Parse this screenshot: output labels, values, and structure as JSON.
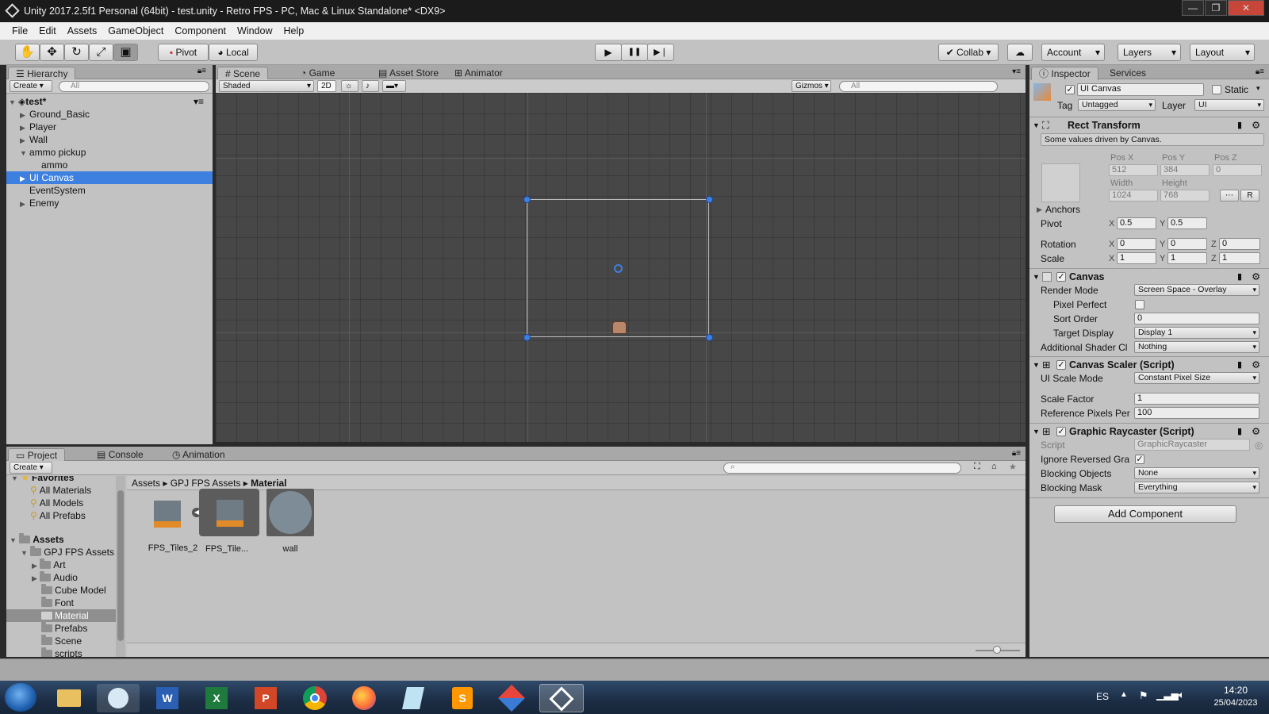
{
  "window": {
    "title": "Unity 2017.2.5f1 Personal (64bit) - test.unity - Retro FPS - PC, Mac & Linux Standalone* <DX9>",
    "minimize": "—",
    "maximize": "❐",
    "close": "✕"
  },
  "menu": [
    "File",
    "Edit",
    "Assets",
    "GameObject",
    "Component",
    "Window",
    "Help"
  ],
  "toolbar": {
    "pivot": "Pivot",
    "local": "Local",
    "collab": "Collab",
    "account": "Account",
    "layers": "Layers",
    "layout": "Layout",
    "play": "▶",
    "pause": "❚❚",
    "step": "▶❘"
  },
  "hierarchy": {
    "tab": "Hierarchy",
    "create": "Create",
    "search": "All",
    "scene": "test*",
    "items": [
      "Ground_Basic",
      "Player",
      "Wall",
      "ammo pickup",
      "ammo",
      "UI Canvas",
      "EventSystem",
      "Enemy"
    ]
  },
  "center_tabs": [
    "Scene",
    "Game",
    "Asset Store",
    "Animator"
  ],
  "scene_bar": {
    "shading": "Shaded",
    "mode2d": "2D",
    "gizmos": "Gizmos",
    "search": "All"
  },
  "inspector": {
    "tabs": [
      "Inspector",
      "Services"
    ],
    "object_name": "UI Canvas",
    "static_label": "Static",
    "tag_label": "Tag",
    "tag_value": "Untagged",
    "layer_label": "Layer",
    "layer_value": "UI",
    "rect_transform": {
      "title": "Rect Transform",
      "note": "Some values driven by Canvas.",
      "pos_x_label": "Pos X",
      "pos_y_label": "Pos Y",
      "pos_z_label": "Pos Z",
      "pos_x": "512",
      "pos_y": "384",
      "pos_z": "0",
      "width_label": "Width",
      "height_label": "Height",
      "width": "1024",
      "height": "768",
      "r_button": "R",
      "anchors": "Anchors",
      "pivot_label": "Pivot",
      "pivot_x": "0.5",
      "pivot_y": "0.5",
      "rotation_label": "Rotation",
      "rot_x": "0",
      "rot_y": "0",
      "rot_z": "0",
      "scale_label": "Scale",
      "scale_x": "1",
      "scale_y": "1",
      "scale_z": "1",
      "x": "X",
      "y": "Y",
      "z": "Z"
    },
    "canvas": {
      "title": "Canvas",
      "render_mode_label": "Render Mode",
      "render_mode": "Screen Space - Overlay",
      "pixel_perfect_label": "Pixel Perfect",
      "sort_order_label": "Sort Order",
      "sort_order": "0",
      "target_display_label": "Target Display",
      "target_display": "Display 1",
      "shader_label": "Additional Shader Cl",
      "shader_value": "Nothing"
    },
    "scaler": {
      "title": "Canvas Scaler (Script)",
      "mode_label": "UI Scale Mode",
      "mode_value": "Constant Pixel Size",
      "factor_label": "Scale Factor",
      "factor_value": "1",
      "ref_label": "Reference Pixels Per",
      "ref_value": "100"
    },
    "raycaster": {
      "title": "Graphic Raycaster (Script)",
      "script_label": "Script",
      "script_value": "GraphicRaycaster",
      "ignore_label": "Ignore Reversed Gra",
      "blocking_label": "Blocking Objects",
      "blocking_value": "None",
      "mask_label": "Blocking Mask",
      "mask_value": "Everything"
    },
    "add_component": "Add Component"
  },
  "bottom_tabs": [
    "Project",
    "Console",
    "Animation"
  ],
  "project": {
    "create": "Create",
    "favorites": "Favorites",
    "fav_items": [
      "All Materials",
      "All Models",
      "All Prefabs"
    ],
    "assets": "Assets",
    "gpj": "GPJ FPS Assets",
    "folders": [
      "Art",
      "Audio",
      "Cube Model",
      "Font",
      "Material",
      "Prefabs",
      "Scene",
      "scripts"
    ],
    "breadcrumb": [
      "Assets",
      "GPJ FPS Assets",
      "Material"
    ],
    "files": [
      "FPS_Tiles_2",
      "FPS_Tile...",
      "wall"
    ]
  },
  "taskbar": {
    "lang": "ES",
    "time": "14:20",
    "date": "25/04/2023"
  }
}
